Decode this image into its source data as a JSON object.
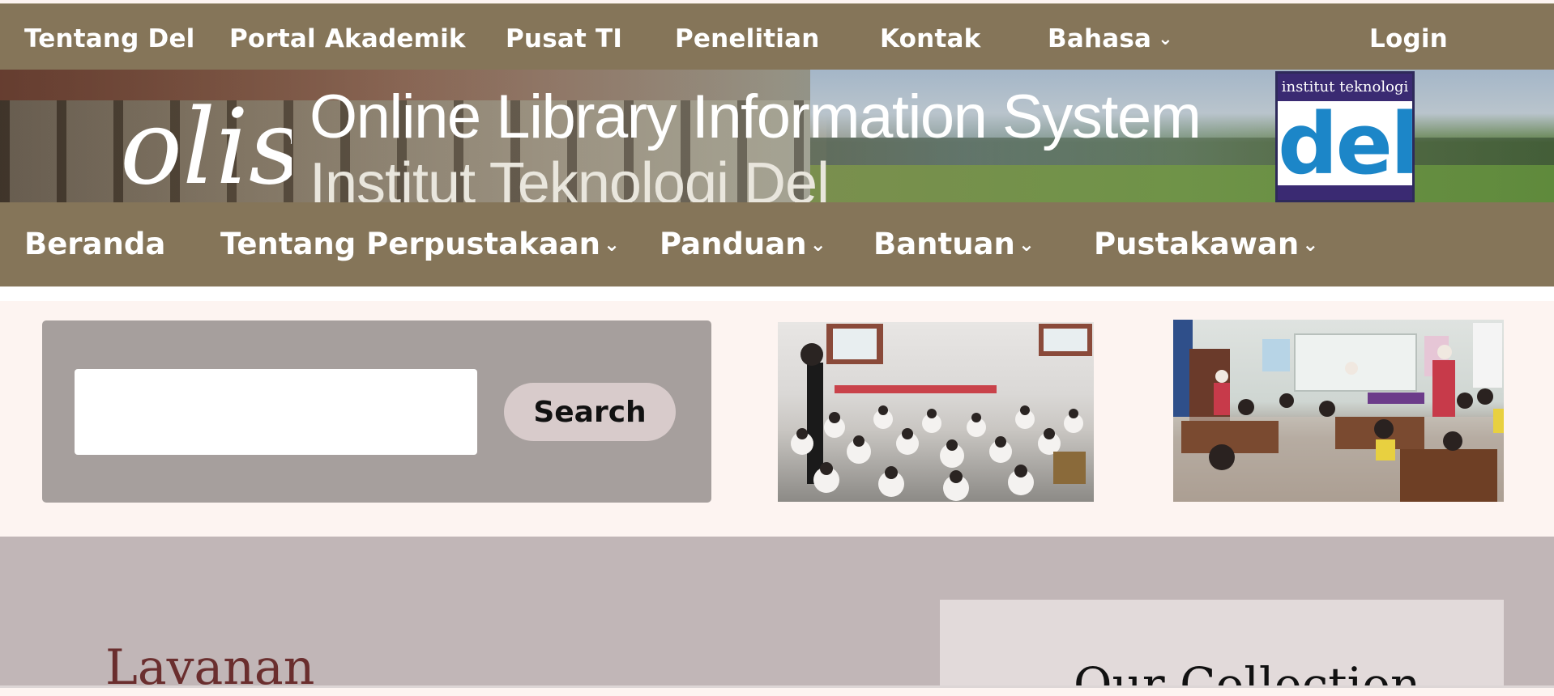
{
  "top_nav": {
    "items": [
      {
        "label": "Tentang Del"
      },
      {
        "label": "Portal Akademik"
      },
      {
        "label": "Pusat TI"
      },
      {
        "label": "Penelitian"
      },
      {
        "label": "Kontak"
      },
      {
        "label": "Bahasa"
      }
    ],
    "login_label": "Login"
  },
  "banner": {
    "logo_text": "olis",
    "title": "Online Library Information System",
    "subtitle": "Institut Teknologi Del",
    "badge_top": "institut teknologi",
    "badge_word": "del"
  },
  "main_nav": {
    "items": [
      {
        "label": "Beranda"
      },
      {
        "label": "Tentang Perpustakaan"
      },
      {
        "label": "Panduan"
      },
      {
        "label": "Bantuan"
      },
      {
        "label": "Pustakawan"
      }
    ]
  },
  "search": {
    "input_value": "",
    "button_label": "Search"
  },
  "sections": {
    "services_heading": "Lavanan",
    "collection_heading": "Our Collection"
  },
  "colors": {
    "nav_bg": "#857559",
    "search_panel": "#a69f9d",
    "search_button": "#d8cbcb",
    "lower_bg": "#c1b6b7",
    "heading_red": "#6a2e2e"
  }
}
